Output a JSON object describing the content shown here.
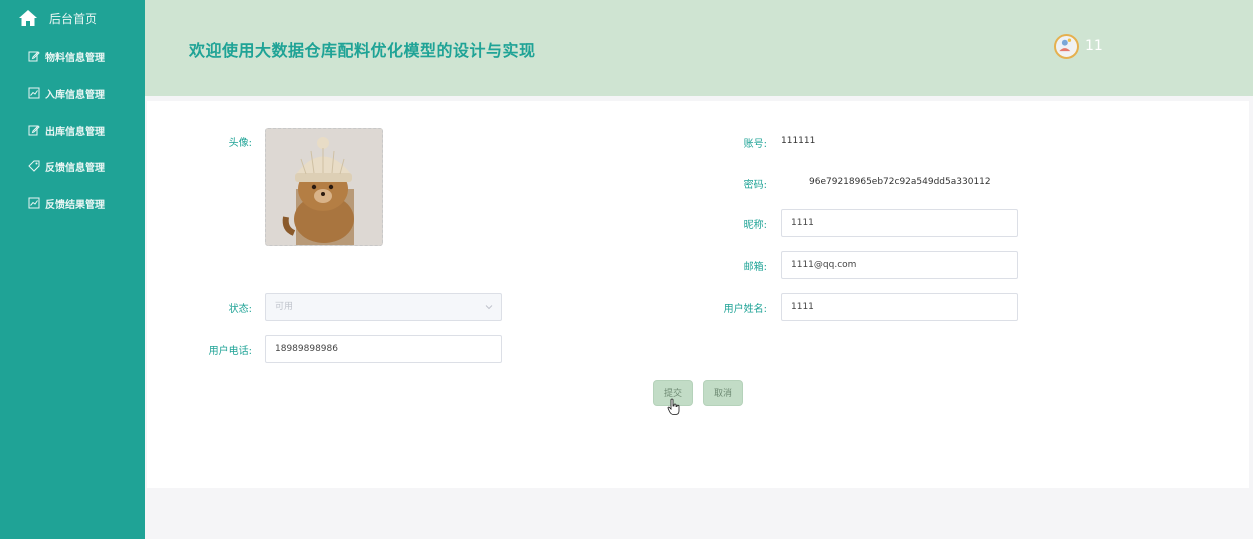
{
  "sidebar": {
    "home": {
      "label": "后台首页",
      "icon": "home-icon"
    },
    "items": [
      {
        "label": "物料信息管理",
        "icon": "edit-icon"
      },
      {
        "label": "入库信息管理",
        "icon": "chart-icon"
      },
      {
        "label": "出库信息管理",
        "icon": "edit-icon"
      },
      {
        "label": "反馈信息管理",
        "icon": "tag-icon"
      },
      {
        "label": "反馈结果管理",
        "icon": "chart-icon"
      }
    ]
  },
  "header": {
    "title": "欢迎使用大数据仓库配料优化模型的设计与实现",
    "username": "11"
  },
  "form": {
    "avatar_label": "头像:",
    "account_label": "账号:",
    "account_value": "111111",
    "password_label": "密码:",
    "password_value": "96e79218965eb72c92a549dd5a330112",
    "nickname_label": "昵称:",
    "nickname_value": "1111",
    "email_label": "邮箱:",
    "email_value": "1111@qq.com",
    "status_label": "状态:",
    "status_value": "可用",
    "realname_label": "用户姓名:",
    "realname_value": "1111",
    "phone_label": "用户电话:",
    "phone_value": "18989898986"
  },
  "buttons": {
    "submit": "提交",
    "cancel": "取消"
  },
  "colors": {
    "sidebar": "#1fa396",
    "header": "#cfe4d2",
    "accent": "#1fa396",
    "button": "#c2dcc6"
  }
}
